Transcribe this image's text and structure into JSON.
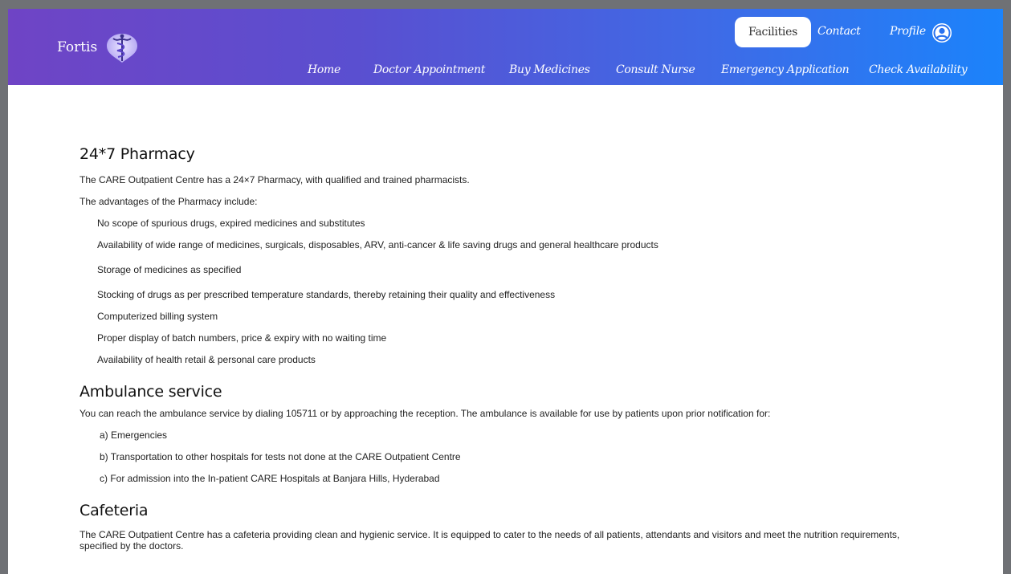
{
  "brand": {
    "name": "Fortis"
  },
  "top_nav": {
    "facilities": "Facilities",
    "contact": "Contact",
    "profile": "Profile"
  },
  "main_nav": {
    "home": "Home",
    "doctor_appointment": "Doctor Appointment",
    "buy_medicines": "Buy Medicines",
    "consult_nurse": "Consult Nurse",
    "emergency_application": "Emergency Application",
    "check_availability": "Check Availability"
  },
  "colors": {
    "header_gradient_start": "#6f44c5",
    "header_gradient_end": "#1b83fb",
    "page_background": "#ffffff",
    "outer_background": "#6f7175"
  },
  "icons": {
    "logo": "caduceus-logo-icon",
    "profile": "user-circle-icon"
  },
  "sections": {
    "pharmacy": {
      "title": "24*7 Pharmacy",
      "intro": "The CARE Outpatient Centre has a 24×7 Pharmacy, with qualified and trained pharmacists.",
      "advantages_heading": "The advantages of the Pharmacy include:",
      "items": [
        "No scope of spurious drugs, expired medicines and substitutes",
        "Availability of wide range of medicines, surgicals, disposables, ARV, anti-cancer & life saving drugs and general healthcare products",
        "Storage of medicines as specified",
        "Stocking of drugs as per prescribed temperature standards, thereby retaining their quality and effectiveness",
        "Computerized billing system",
        "Proper display of batch numbers, price & expiry with no waiting time",
        "Availability of health retail & personal care products"
      ]
    },
    "ambulance": {
      "title": "Ambulance service",
      "intro": "You can reach the ambulance service by dialing 105711 or by approaching the reception. The ambulance is available for use by patients upon prior notification for:",
      "items": [
        "a) Emergencies",
        "b) Transportation to other hospitals for tests not done at the CARE Outpatient Centre",
        "c) For admission into the In-patient CARE Hospitals at Banjara Hills, Hyderabad"
      ]
    },
    "cafeteria": {
      "title": "Cafeteria",
      "intro": "The CARE Outpatient Centre has a cafeteria providing clean and hygienic service. It is equipped to cater to the needs of all patients, attendants and visitors and meet the nutrition requirements, specified by the doctors."
    }
  }
}
